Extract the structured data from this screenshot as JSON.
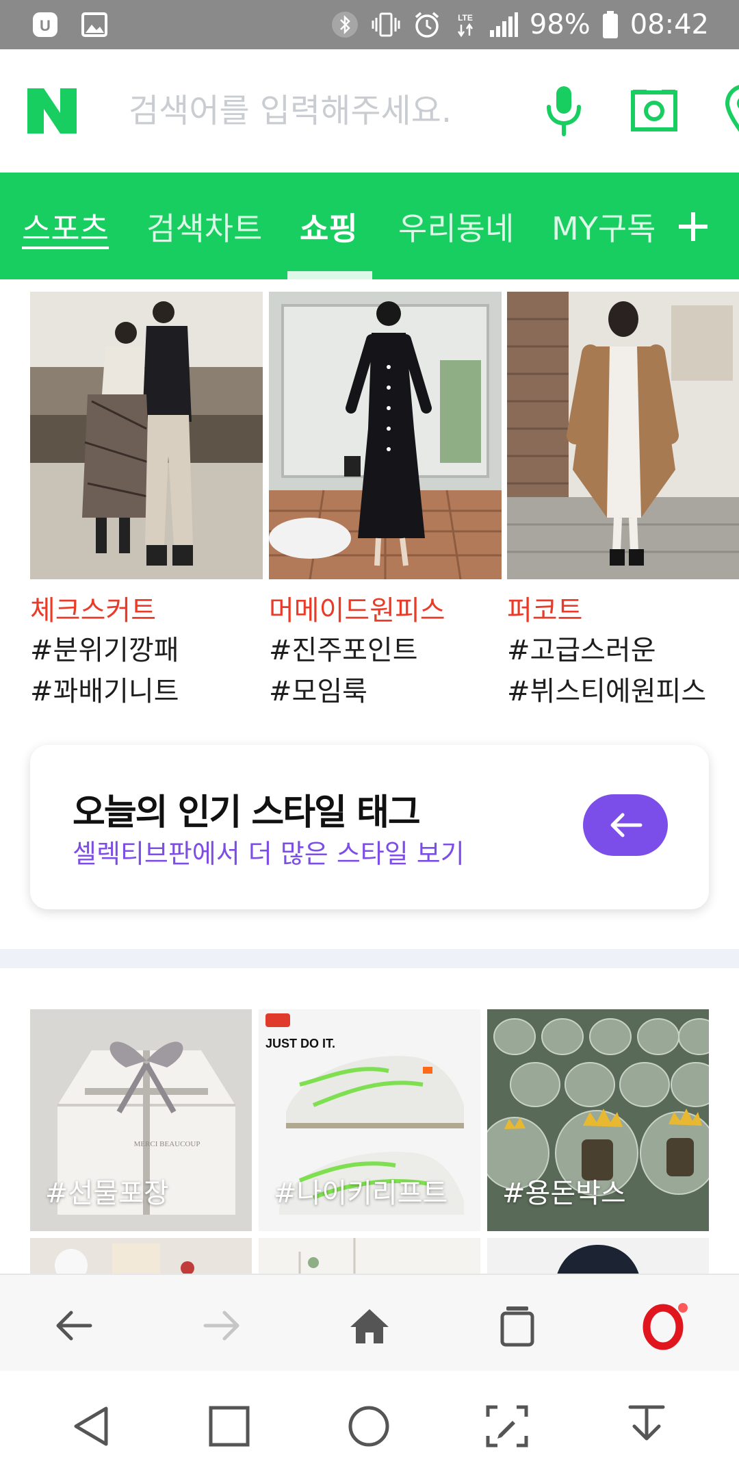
{
  "status_bar": {
    "battery": "98%",
    "time": "08:42",
    "network": "LTE"
  },
  "search": {
    "logo": "N",
    "placeholder": "검색어를 입력해주세요.",
    "icons": [
      "microphone-icon",
      "camera-lens-icon",
      "location-pin-icon"
    ]
  },
  "tabs": [
    {
      "label": "스포츠"
    },
    {
      "label": "검색차트"
    },
    {
      "label": "쇼핑"
    },
    {
      "label": "우리동네"
    },
    {
      "label": "MY구독"
    }
  ],
  "active_tab": "쇼핑",
  "style_cards": [
    {
      "title": "체크스커트",
      "tags": [
        "#분위기깡패",
        "#꽈배기니트"
      ]
    },
    {
      "title": "머메이드원피스",
      "tags": [
        "#진주포인트",
        "#모임룩"
      ]
    },
    {
      "title": "퍼코트",
      "tags": [
        "#고급스러운",
        "#뷔스티에원피스"
      ]
    }
  ],
  "promo": {
    "title": "오늘의 인기 스타일 태그",
    "subtitle": "셀렉티브판에서 더 많은 스타일 보기"
  },
  "gift_tiles": [
    {
      "label": "#선물포장",
      "mark": "MERCI BEAUCOUP"
    },
    {
      "label": "#나이키리프트",
      "mark": "JUST DO IT."
    },
    {
      "label": "#용돈박스"
    }
  ],
  "colors": {
    "naver_green": "#19ce60",
    "accent_red": "#ea3a28",
    "accent_purple": "#7c4ee9",
    "status_gray": "#8a8a8a"
  }
}
